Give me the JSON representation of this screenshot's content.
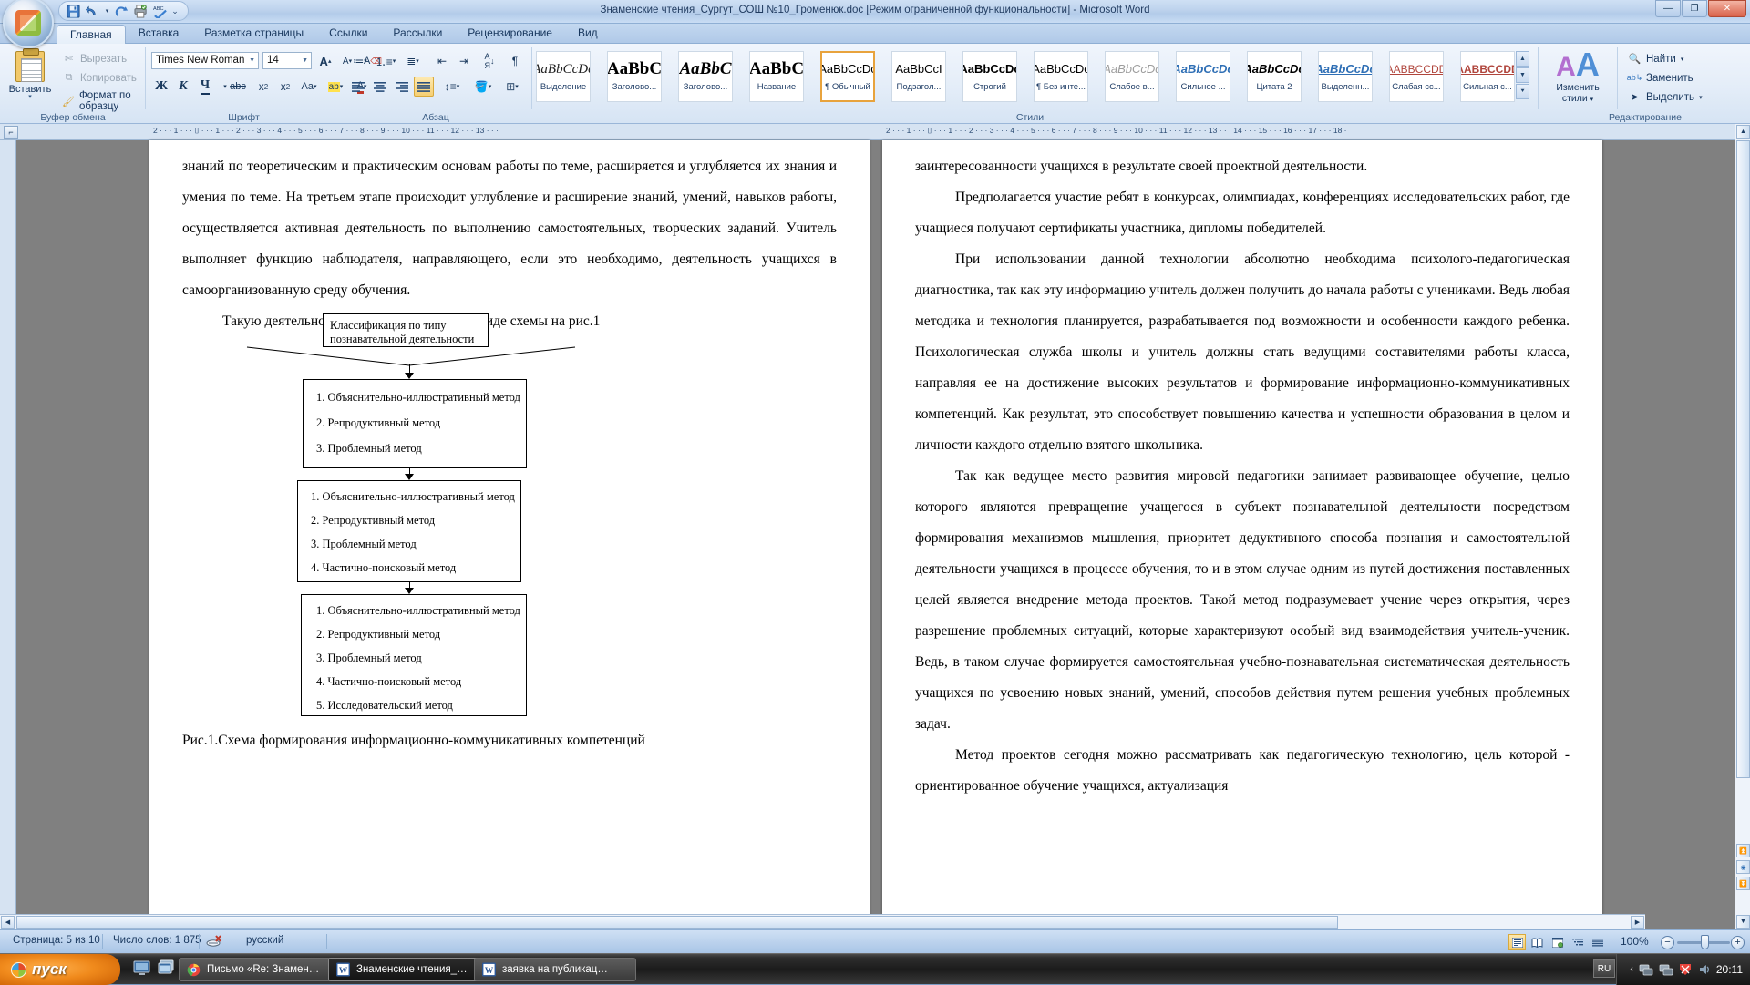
{
  "window": {
    "title": "Знаменские чтения_Сургут_СОШ №10_Громенюк.doc [Режим ограниченной функциональности] - Microsoft Word",
    "minimize": "—",
    "restore": "❐",
    "close": "✕"
  },
  "quick_access": {
    "office_button": "office-logo",
    "items": [
      {
        "name": "save",
        "glyph": "💾"
      },
      {
        "name": "undo",
        "glyph": "↰"
      },
      {
        "name": "undo-dropdown",
        "glyph": "▾"
      },
      {
        "name": "redo",
        "glyph": "↻"
      },
      {
        "name": "print-preview",
        "glyph": "🖨"
      },
      {
        "name": "spelling",
        "glyph": "ABC"
      },
      {
        "name": "customize-qat",
        "glyph": "▾"
      }
    ]
  },
  "tabs": [
    {
      "label": "Главная",
      "active": true
    },
    {
      "label": "Вставка",
      "active": false
    },
    {
      "label": "Разметка страницы",
      "active": false
    },
    {
      "label": "Ссылки",
      "active": false
    },
    {
      "label": "Рассылки",
      "active": false
    },
    {
      "label": "Рецензирование",
      "active": false
    },
    {
      "label": "Вид",
      "active": false
    }
  ],
  "ribbon": {
    "clipboard": {
      "group_label": "Буфер обмена",
      "paste_label": "Вставить",
      "cut_label": "Вырезать",
      "copy_label": "Копировать",
      "format_painter_label": "Формат по образцу"
    },
    "font": {
      "group_label": "Шрифт",
      "font_name": "Times New Roman",
      "font_size": "14",
      "buttons": [
        {
          "name": "grow-font",
          "glyph": "A▴"
        },
        {
          "name": "shrink-font",
          "glyph": "A▾"
        },
        {
          "name": "clear-formatting",
          "glyph": "A⌫"
        },
        {
          "name": "bold",
          "glyph": "Ж"
        },
        {
          "name": "italic",
          "glyph": "К"
        },
        {
          "name": "underline",
          "glyph": "Ч"
        },
        {
          "name": "strikethrough",
          "glyph": "abc"
        },
        {
          "name": "subscript",
          "glyph": "x₂"
        },
        {
          "name": "superscript",
          "glyph": "x²"
        },
        {
          "name": "change-case",
          "glyph": "Aa"
        },
        {
          "name": "text-highlight",
          "glyph": "ab"
        },
        {
          "name": "font-color",
          "glyph": "A"
        }
      ]
    },
    "paragraph": {
      "group_label": "Абзац",
      "buttons": [
        {
          "name": "bullets",
          "glyph": "≔"
        },
        {
          "name": "numbering",
          "glyph": "≕"
        },
        {
          "name": "multilevel-list",
          "glyph": "≡"
        },
        {
          "name": "decrease-indent",
          "glyph": "⇤"
        },
        {
          "name": "increase-indent",
          "glyph": "⇥"
        },
        {
          "name": "sort",
          "glyph": "A↓"
        },
        {
          "name": "show-formatting-marks",
          "glyph": "¶"
        },
        {
          "name": "align-left",
          "glyph": "≡"
        },
        {
          "name": "align-center",
          "glyph": "≡"
        },
        {
          "name": "align-right",
          "glyph": "≡"
        },
        {
          "name": "justify",
          "glyph": "≡"
        },
        {
          "name": "line-spacing",
          "glyph": "↕≡"
        },
        {
          "name": "shading",
          "glyph": "▲"
        },
        {
          "name": "borders",
          "glyph": "⊞"
        }
      ]
    },
    "styles": {
      "group_label": "Стили",
      "gallery": [
        {
          "sample": "AaBbCcDc",
          "name": "Выделение",
          "style": "italic-serif",
          "current": false
        },
        {
          "sample": "AaBbC",
          "name": "Заголово...",
          "style": "bold-serif",
          "current": false
        },
        {
          "sample": "AaBbC",
          "name": "Заголово...",
          "style": "bold-italic-serif",
          "current": false
        },
        {
          "sample": "AaBbC",
          "name": "Название",
          "style": "bold-serif",
          "current": false
        },
        {
          "sample": "AaBbCcDc",
          "name": "¶ Обычный",
          "style": "plain-sans",
          "current": true
        },
        {
          "sample": "AaBbCcI",
          "name": "Подзагол...",
          "style": "plain-sans",
          "current": false
        },
        {
          "sample": "AaBbCcDc",
          "name": "Строгий",
          "style": "bold-sans",
          "current": false
        },
        {
          "sample": "AaBbCcDc",
          "name": "¶ Без инте...",
          "style": "plain-sans",
          "current": false
        },
        {
          "sample": "AaBbCcDc",
          "name": "Слабое в...",
          "style": "italic-grey",
          "current": false
        },
        {
          "sample": "AaBbCcDc",
          "name": "Сильное ...",
          "style": "bold-italic-blue",
          "current": false
        },
        {
          "sample": "AaBbCcDc",
          "name": "Цитата 2",
          "style": "bold-italic-sans",
          "current": false
        },
        {
          "sample": "AaBbCcDc",
          "name": "Выделенн...",
          "style": "bold-italic-blue-underline",
          "current": false
        },
        {
          "sample": "AABBCCDD",
          "name": "Слабая сс...",
          "style": "smallcaps-red-underline",
          "current": false
        },
        {
          "sample": "AABBCCDD",
          "name": "Сильная с...",
          "style": "smallcaps-red-bold-underline",
          "current": false
        }
      ]
    },
    "editing": {
      "group_label": "Редактирование",
      "change_styles_label_1": "Изменить",
      "change_styles_label_2": "стили",
      "find_label": "Найти",
      "replace_label": "Заменить",
      "select_label": "Выделить"
    }
  },
  "ruler": {
    "left_ticks": "2 · · · 1 · · · ⌷ · · · 1 · · · 2 · · · 3 · · · 4 · · · 5 · · · 6 · · · 7 · · · 8 · · · 9 · · · 10 · · · 11 · · · 12 · · · 13 · · ·",
    "right_ticks": "2 · · · 1 · · · ⌷ · · · 1 · · · 2 · · · 3 · · · 4 · · · 5 · · · 6 · · · 7 · · · 8 · · · 9 · · · 10 · · · 11 · · · 12 · · · 13 · · · 14 · · · 15 · · · 16 · · · 17 · · · 18 ·",
    "corner_glyph": "⌐"
  },
  "document": {
    "left_page": {
      "paragraphs": [
        "знаний по теоретическим и практическим основам работы по теме, расширяется и углубляется их знания и умения по теме. На  третьем этапе происходит углубление и расширение знаний, умений, навыков работы, осуществляется активная деятельность по выполнению самостоятельных, творческих заданий. Учитель выполняет функцию наблюдателя, направляющего, если это необходимо, деятельность учащихся в самоорганизованную среду обучения.",
        "Такую деятельность можно представить в виде схемы на рис.1"
      ],
      "caption": "Рис.1.Схема     формирования     информационно-коммуникативных компетенций"
    },
    "diagram": {
      "title": "Классификация         по         типу познавательной деятельности",
      "box1": [
        "1.  Объяснительно-иллюстративный метод",
        "2.  Репродуктивный метод",
        "3.  Проблемный метод"
      ],
      "box2": [
        "1.  Объяснительно-иллюстративный метод",
        "2.   Репродуктивный метод",
        "3.  Проблемный метод",
        "4.  Частично-поисковый метод"
      ],
      "box3": [
        "1.  Объяснительно-иллюстративный метод",
        "2.  Репродуктивный метод",
        "3.  Проблемный метод",
        "4.  Частично-поисковый метод",
        "5.  Исследовательский метод"
      ]
    },
    "right_page": {
      "paragraphs": [
        "заинтересованности учащихся  в результате своей проектной деятельности.",
        "Предполагается участие ребят в конкурсах, олимпиадах, конференциях исследовательских работ, где  учащиеся получают сертификаты участника, дипломы победителей.",
        "При использовании данной технологии абсолютно необходима психолого-педагогическая диагностика, так как эту информацию учитель должен получить до начала работы с учениками.  Ведь  любая методика и технология планируется, разрабатывается под возможности и особенности каждого ребенка. Психологическая  служба школы и учитель должны стать ведущими составителями  работы класса, направляя ее на достижение высоких результатов и формирование информационно-коммуникативных компетенций. Как  результат, это  способствует  повышению  качества  и  успешности образования в целом и личности каждого отдельно взятого школьника.",
        "Так  как  ведущее  место  развития  мировой  педагогики  занимает развивающее обучение,  целью которого являются превращение учащегося в субъект познавательной деятельности посредством формирования механизмов мышления,  приоритет дедуктивного способа познания и самостоятельной деятельности учащихся в процессе обучения, то и в этом случае одним из путей достижения поставленных целей является внедрение метода проектов. Такой метод подразумевает учение через открытия, через разрешение проблемных ситуаций, которые характеризуют особый вид взаимодействия учитель-ученик. Ведь, в таком случае формируется самостоятельная учебно-познавательная систематическая деятельность учащихся по усвоению новых знаний, умений, способов действия путем решения учебных проблемных задач.",
        "Метод  проектов  сегодня  можно  рассматривать  как  педагогическую технологию, цель которой - ориентированное обучение учащихся, актуализация"
      ]
    }
  },
  "status_bar": {
    "page": "Страница: 5 из 10",
    "words": "Число слов: 1 875",
    "language": "русский",
    "zoom_level": "100%",
    "views": [
      {
        "name": "print-layout-view",
        "glyph": "▤",
        "active": true
      },
      {
        "name": "full-screen-reading-view",
        "glyph": "📖",
        "active": false
      },
      {
        "name": "web-layout-view",
        "glyph": "▣",
        "active": false
      },
      {
        "name": "outline-view",
        "glyph": "⋮≡",
        "active": false
      },
      {
        "name": "draft-view",
        "glyph": "▤",
        "active": false
      }
    ],
    "zoom_out": "−",
    "zoom_in": "+"
  },
  "taskbar": {
    "start_label": "пуск",
    "quick_launch": [
      {
        "name": "show-desktop-icon"
      },
      {
        "name": "switch-windows-icon"
      },
      {
        "name": "chrome-icon"
      },
      {
        "name": "more-icon",
        "glyph": "»"
      }
    ],
    "buttons": [
      {
        "label": "Письмо «Re: Знамен…",
        "icon": "chrome-icon",
        "active": false
      },
      {
        "label": "Знаменские чтения_…",
        "icon": "word-icon",
        "active": true
      },
      {
        "label": "заявка на публикац…",
        "icon": "word-icon",
        "active": false
      }
    ],
    "language_indicator": "RU",
    "clock": "20:11",
    "tray": [
      {
        "name": "network-icon"
      },
      {
        "name": "network2-icon"
      },
      {
        "name": "antivirus-icon"
      },
      {
        "name": "volume-icon"
      }
    ]
  }
}
